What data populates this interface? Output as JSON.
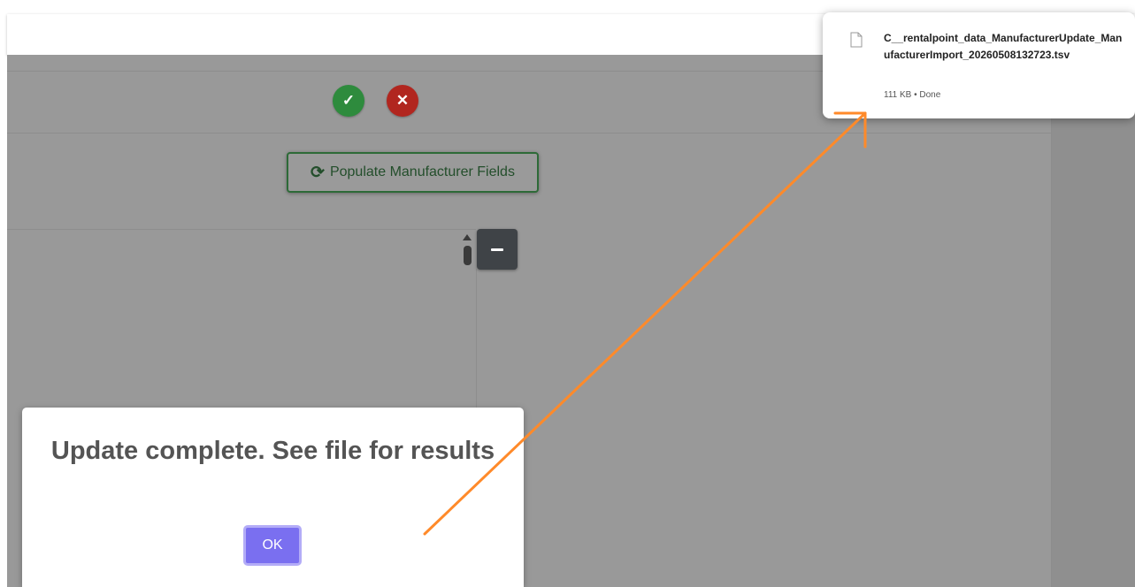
{
  "toolbar": {
    "confirm_icon": "check-icon",
    "cancel_icon": "x-icon",
    "confirm_color": "#2e8b3d",
    "cancel_color": "#b1261f",
    "populate_label": "Populate Manufacturer Fields",
    "populate_icon": "refresh-icon"
  },
  "panel": {
    "collapse_icon": "minus-icon"
  },
  "modal": {
    "message": "Update complete. See file for results",
    "ok_label": "OK",
    "ok_color": "#7a6ff0"
  },
  "download": {
    "filename": "C__rentalpoint_data_ManufacturerUpdate_ManufacturerImport_20260508132723.tsv",
    "status": "111 KB • Done",
    "icon": "file-icon"
  },
  "annotation": {
    "color": "#ff8a2a"
  }
}
